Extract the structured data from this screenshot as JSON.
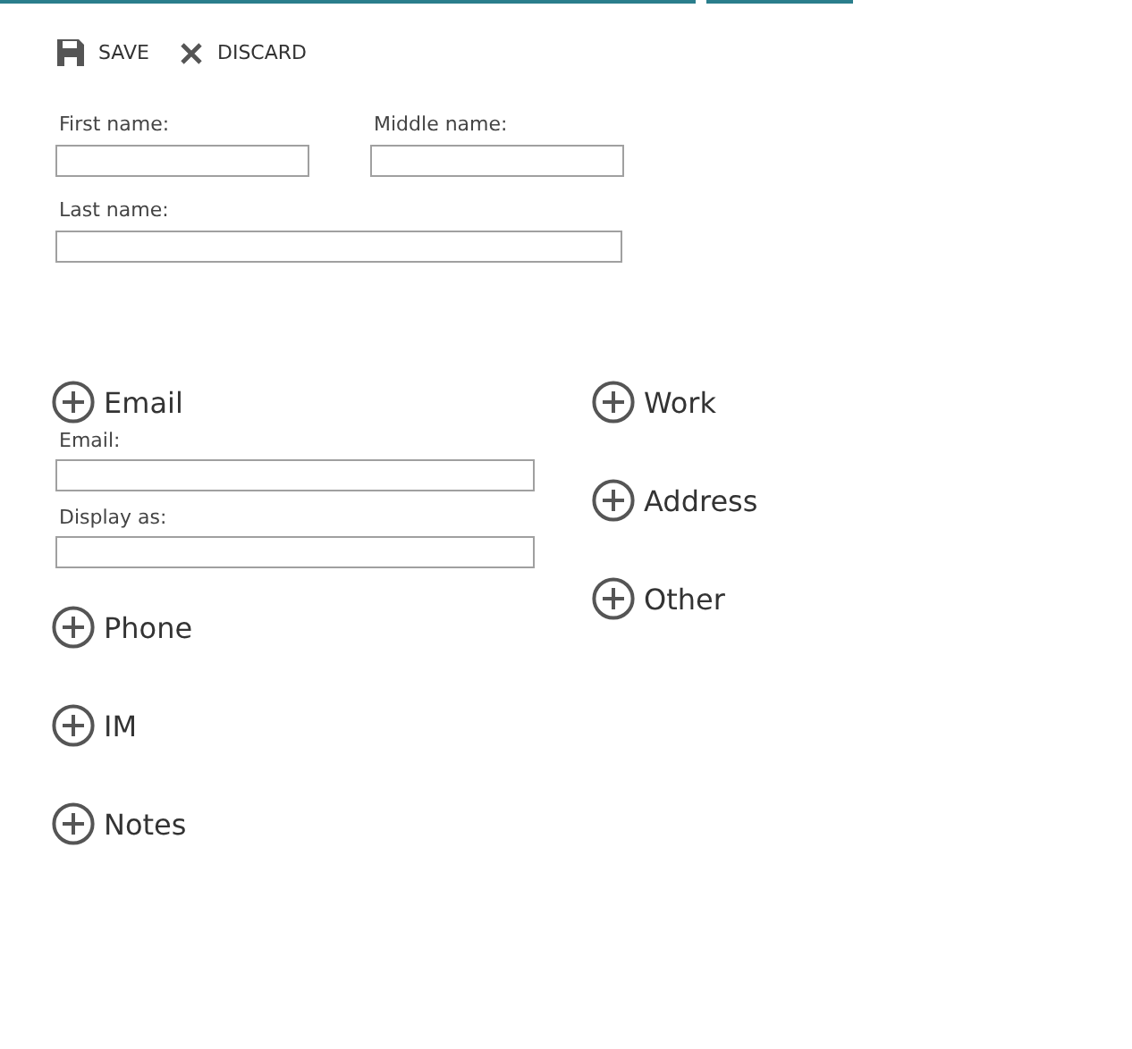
{
  "toolbar": [
    {
      "kind": "save",
      "label": "SAVE"
    },
    {
      "kind": "discard",
      "label": "DISCARD"
    }
  ],
  "name_fields": [
    [
      {
        "label": "First name:",
        "wide": false
      },
      {
        "label": "Middle name:",
        "wide": false
      }
    ],
    [
      {
        "label": "Last name:",
        "wide": true
      }
    ]
  ],
  "sections_left": [
    {
      "title": "Email",
      "fields": [
        {
          "label": "Email:"
        },
        {
          "label": "Display as:"
        }
      ]
    },
    {
      "title": "Phone"
    },
    {
      "title": "IM"
    },
    {
      "title": "Notes"
    }
  ],
  "sections_right": [
    {
      "title": "Work"
    },
    {
      "title": "Address"
    },
    {
      "title": "Other"
    }
  ]
}
